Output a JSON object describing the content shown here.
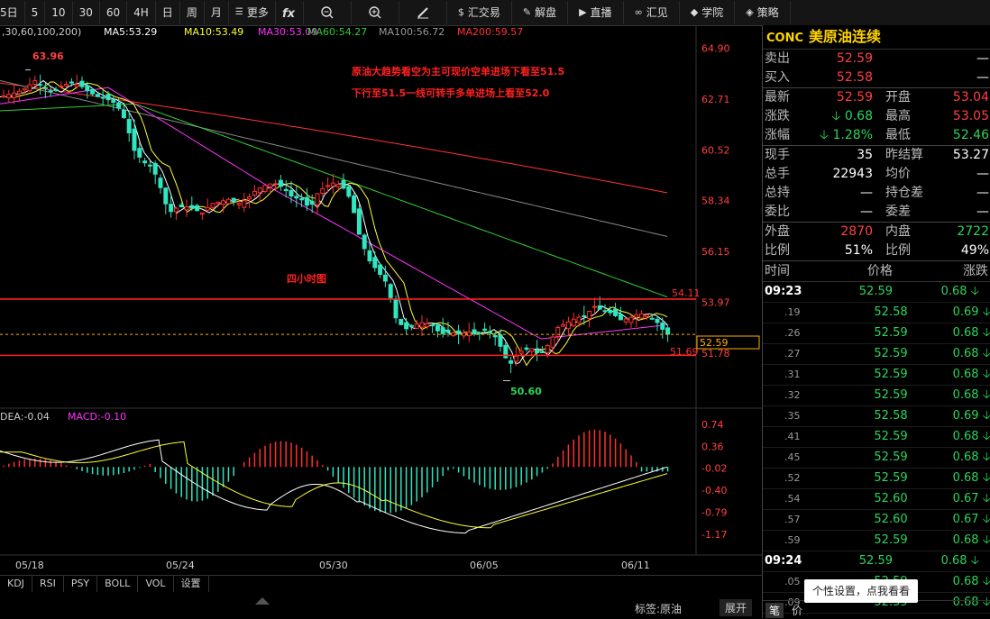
{
  "toolbar": {
    "items": [
      "5日",
      "5",
      "10",
      "30",
      "60",
      "4H",
      "日",
      "周",
      "月",
      "更多",
      "fx",
      "",
      "",
      "",
      "汇交易",
      "解盘",
      "直播",
      "汇见",
      "学院",
      "策略"
    ]
  },
  "legend_top": {
    "params": ",30,60,100,200)",
    "ma5": "MA5:53.29",
    "ma10": "MA10:53.49",
    "ma30": "MA30:53.09",
    "ma60": "MA60:54.27",
    "ma100": "MA100:56.72",
    "ma200": "MA200:59.57"
  },
  "legend_macd": {
    "dea": "DEA:-0.04",
    "macd": "MACD:-0.10"
  },
  "annotations": {
    "line1": "原油大趋势看空为主可现价空单进场下看至51.5",
    "line2": "下行至51.5一线可转手多单进场上看至52.0",
    "period": "四小时图",
    "high": "63.96",
    "low": "50.60",
    "level_top": "54.11",
    "level_bottom": "51.69",
    "current": "52.59"
  },
  "colors": {
    "ma5": "#ffffff",
    "ma10": "#ffff33",
    "ma30": "#ff33ff",
    "ma60": "#33cc33",
    "ma100": "#888888",
    "ma200": "#ff3333",
    "up": "#ff3030",
    "down": "#2ee6c0"
  },
  "chart_data": {
    "type": "candlestick",
    "price_axis": [
      "64.90",
      "62.71",
      "60.52",
      "58.34",
      "56.15",
      "53.97",
      "51.78"
    ],
    "macd_axis": [
      "0.74",
      "0.36",
      "-0.02",
      "-0.40",
      "-0.79",
      "-1.17"
    ],
    "x_labels": [
      "05/18",
      "05/24",
      "05/30",
      "06/05",
      "06/11"
    ],
    "ylim": [
      50.0,
      65.3
    ],
    "levels": [
      54.11,
      51.69
    ],
    "current_price": 52.59
  },
  "indicator_tabs": [
    "KDJ",
    "RSI",
    "PSY",
    "BOLL",
    "VOL",
    "设置"
  ],
  "bottom": {
    "label": "标签:原油",
    "expand": "展开",
    "tab1": "笔",
    "tab2": "价"
  },
  "quote": {
    "code": "CONC",
    "name": "美原油连续",
    "rows": [
      {
        "k": "卖出",
        "v": "52.59",
        "vc": "red",
        "k2": "",
        "v2": "—",
        "v2c": "white"
      },
      {
        "k": "买入",
        "v": "52.58",
        "vc": "red",
        "k2": "",
        "v2": "—",
        "v2c": "white"
      },
      {
        "k": "最新",
        "v": "52.59",
        "vc": "red",
        "k2": "开盘",
        "v2": "53.04",
        "v2c": "red"
      },
      {
        "k": "涨跌",
        "v": "0.68",
        "vc": "green",
        "k2": "最高",
        "v2": "53.05",
        "v2c": "red"
      },
      {
        "k": "涨幅",
        "v": "1.28%",
        "vc": "green",
        "k2": "最低",
        "v2": "52.46",
        "v2c": "green"
      },
      {
        "k": "现手",
        "v": "35",
        "vc": "white",
        "k2": "昨结算",
        "v2": "53.27",
        "v2c": "white"
      },
      {
        "k": "总手",
        "v": "22943",
        "vc": "white",
        "k2": "均价",
        "v2": "—",
        "v2c": "white"
      },
      {
        "k": "总持",
        "v": "—",
        "vc": "white",
        "k2": "持仓差",
        "v2": "—",
        "v2c": "white"
      },
      {
        "k": "委比",
        "v": "—",
        "vc": "white",
        "k2": "委差",
        "v2": "—",
        "v2c": "white"
      },
      {
        "k": "外盘",
        "v": "2870",
        "vc": "red",
        "k2": "内盘",
        "v2": "2722",
        "v2c": "green"
      },
      {
        "k": "比例",
        "v": "51%",
        "vc": "white",
        "k2": "比例",
        "v2": "49%",
        "v2c": "white"
      }
    ]
  },
  "ticks_header": {
    "time": "时间",
    "price": "价格",
    "change": "涨跌"
  },
  "ticks": [
    {
      "t": "09:23",
      "p": "52.59",
      "c": "0.68",
      "main": true
    },
    {
      "t": ".19",
      "p": "52.58",
      "c": "0.69",
      "main": false
    },
    {
      "t": ".26",
      "p": "52.59",
      "c": "0.68",
      "main": false
    },
    {
      "t": ".27",
      "p": "52.59",
      "c": "0.68",
      "main": false
    },
    {
      "t": ".31",
      "p": "52.59",
      "c": "0.68",
      "main": false
    },
    {
      "t": ".32",
      "p": "52.59",
      "c": "0.68",
      "main": false
    },
    {
      "t": ".35",
      "p": "52.58",
      "c": "0.69",
      "main": false
    },
    {
      "t": ".41",
      "p": "52.59",
      "c": "0.68",
      "main": false
    },
    {
      "t": ".45",
      "p": "52.59",
      "c": "0.68",
      "main": false
    },
    {
      "t": ".52",
      "p": "52.59",
      "c": "0.68",
      "main": false
    },
    {
      "t": ".54",
      "p": "52.60",
      "c": "0.67",
      "main": false
    },
    {
      "t": ".57",
      "p": "52.60",
      "c": "0.67",
      "main": false
    },
    {
      "t": ".59",
      "p": "52.59",
      "c": "0.68",
      "main": false
    },
    {
      "t": "09:24",
      "p": "52.59",
      "c": "0.68",
      "main": true
    },
    {
      "t": ".05",
      "p": "52.59",
      "c": "0.68",
      "main": false
    },
    {
      "t": ".09",
      "p": "52.59",
      "c": "0.68",
      "main": false
    }
  ],
  "tooltip": "个性设置，点我看看"
}
